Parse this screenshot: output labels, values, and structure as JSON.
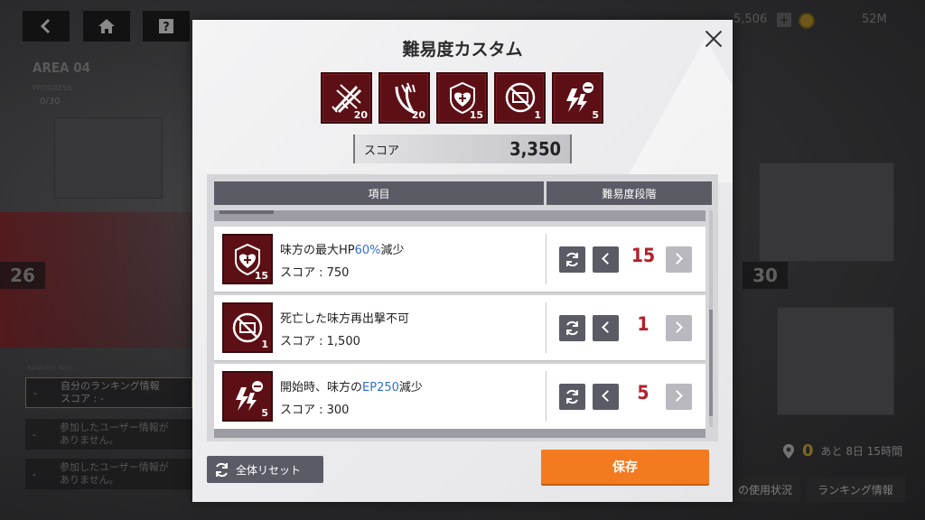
{
  "background": {
    "area_title": "AREA 04",
    "progress_label": "PROGRESS",
    "progress_value": "0/30",
    "left_number": "26",
    "right_number": "30",
    "currency": "5,506",
    "stamina": "52M",
    "ranking_info_label": "RANKING INFO",
    "ranking_rows": [
      {
        "rank": "-",
        "text": "自分のランキング情報\nスコア : -"
      },
      {
        "rank": "-",
        "text": "参加したユーザー情報が\nありません。"
      },
      {
        "rank": "-",
        "text": "参加したユーザー情報が\nありません。"
      }
    ],
    "remaining": {
      "prefix": "0",
      "text": "あと 8日 15時間"
    },
    "tab_usage": "の使用状況",
    "tab_ranking": "ランキング情報"
  },
  "modal": {
    "title": "難易度カスタム",
    "icons": [
      {
        "icon": "attack-down-icon",
        "level": "20"
      },
      {
        "icon": "defense-down-icon",
        "level": "20"
      },
      {
        "icon": "hp-down-icon",
        "level": "15"
      },
      {
        "icon": "no-redeploy-icon",
        "level": "1"
      },
      {
        "icon": "ep-down-icon",
        "level": "5"
      }
    ],
    "score_label": "スコア",
    "score_value": "3,350",
    "table_header_item": "項目",
    "table_header_level": "難易度段階",
    "rows": [
      {
        "icon": "hp-down-icon",
        "icon_level": "15",
        "name_pre": "味方の最大HP",
        "name_hl": "60%",
        "name_post": "減少",
        "score": "スコア : 750",
        "level": "15"
      },
      {
        "icon": "no-redeploy-icon",
        "icon_level": "1",
        "name_pre": "死亡した味方再出撃不可",
        "name_hl": "",
        "name_post": "",
        "score": "スコア : 1,500",
        "level": "1"
      },
      {
        "icon": "ep-down-icon",
        "icon_level": "5",
        "name_pre": "開始時、味方の",
        "name_hl": "EP250",
        "name_post": "減少",
        "score": "スコア : 300",
        "level": "5"
      }
    ],
    "reset_all_label": "全体リセット",
    "save_label": "保存"
  },
  "colors": {
    "accent_orange": "#f47a20",
    "level_red": "#b3202a",
    "highlight_blue": "#2f6fd0",
    "icon_bg": "#5c1016"
  }
}
